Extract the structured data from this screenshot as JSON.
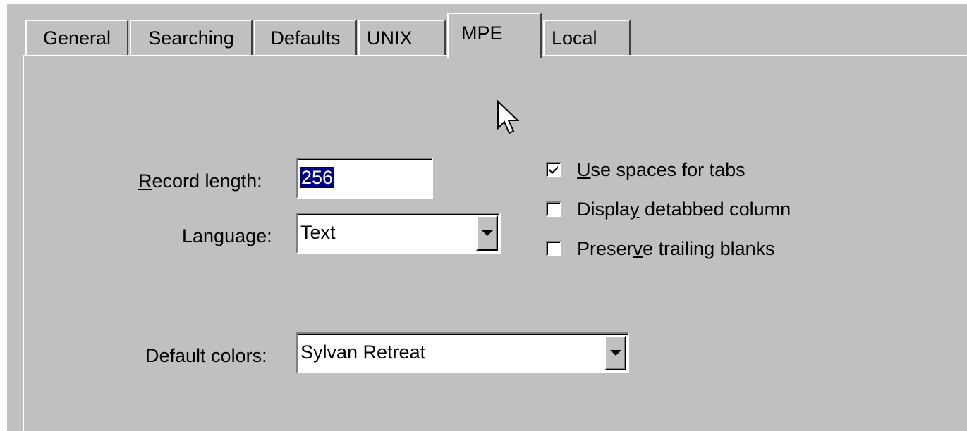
{
  "tabs": [
    {
      "label": "General",
      "active": false
    },
    {
      "label": "Searching",
      "active": false
    },
    {
      "label": "Defaults",
      "active": false
    },
    {
      "label": "UNIX",
      "active": false
    },
    {
      "label": "MPE",
      "active": true
    },
    {
      "label": "Local",
      "active": false
    }
  ],
  "mpe": {
    "record_length": {
      "label_pre": "",
      "label_mnemonic": "R",
      "label_post": "ecord length:",
      "value": "256"
    },
    "language": {
      "label": "Language:",
      "value": "Text"
    },
    "default_colors": {
      "label": "Default colors:",
      "value": "Sylvan Retreat"
    },
    "options": [
      {
        "label_pre": "",
        "label_mnemonic": "U",
        "label_post": "se spaces for tabs",
        "checked": true
      },
      {
        "label_pre": "Displa",
        "label_mnemonic": "y",
        "label_post": " detabbed column",
        "checked": false
      },
      {
        "label_pre": "Preser",
        "label_mnemonic": "v",
        "label_post": "e trailing blanks",
        "checked": false
      }
    ]
  },
  "colors": {
    "dialog_bg": "#c0c0c0",
    "selection_bg": "#000080",
    "selection_fg": "#ffffff"
  },
  "icons": {
    "dropdown": "chevron-down-icon",
    "check": "check-icon",
    "cursor": "mouse-pointer-icon"
  }
}
